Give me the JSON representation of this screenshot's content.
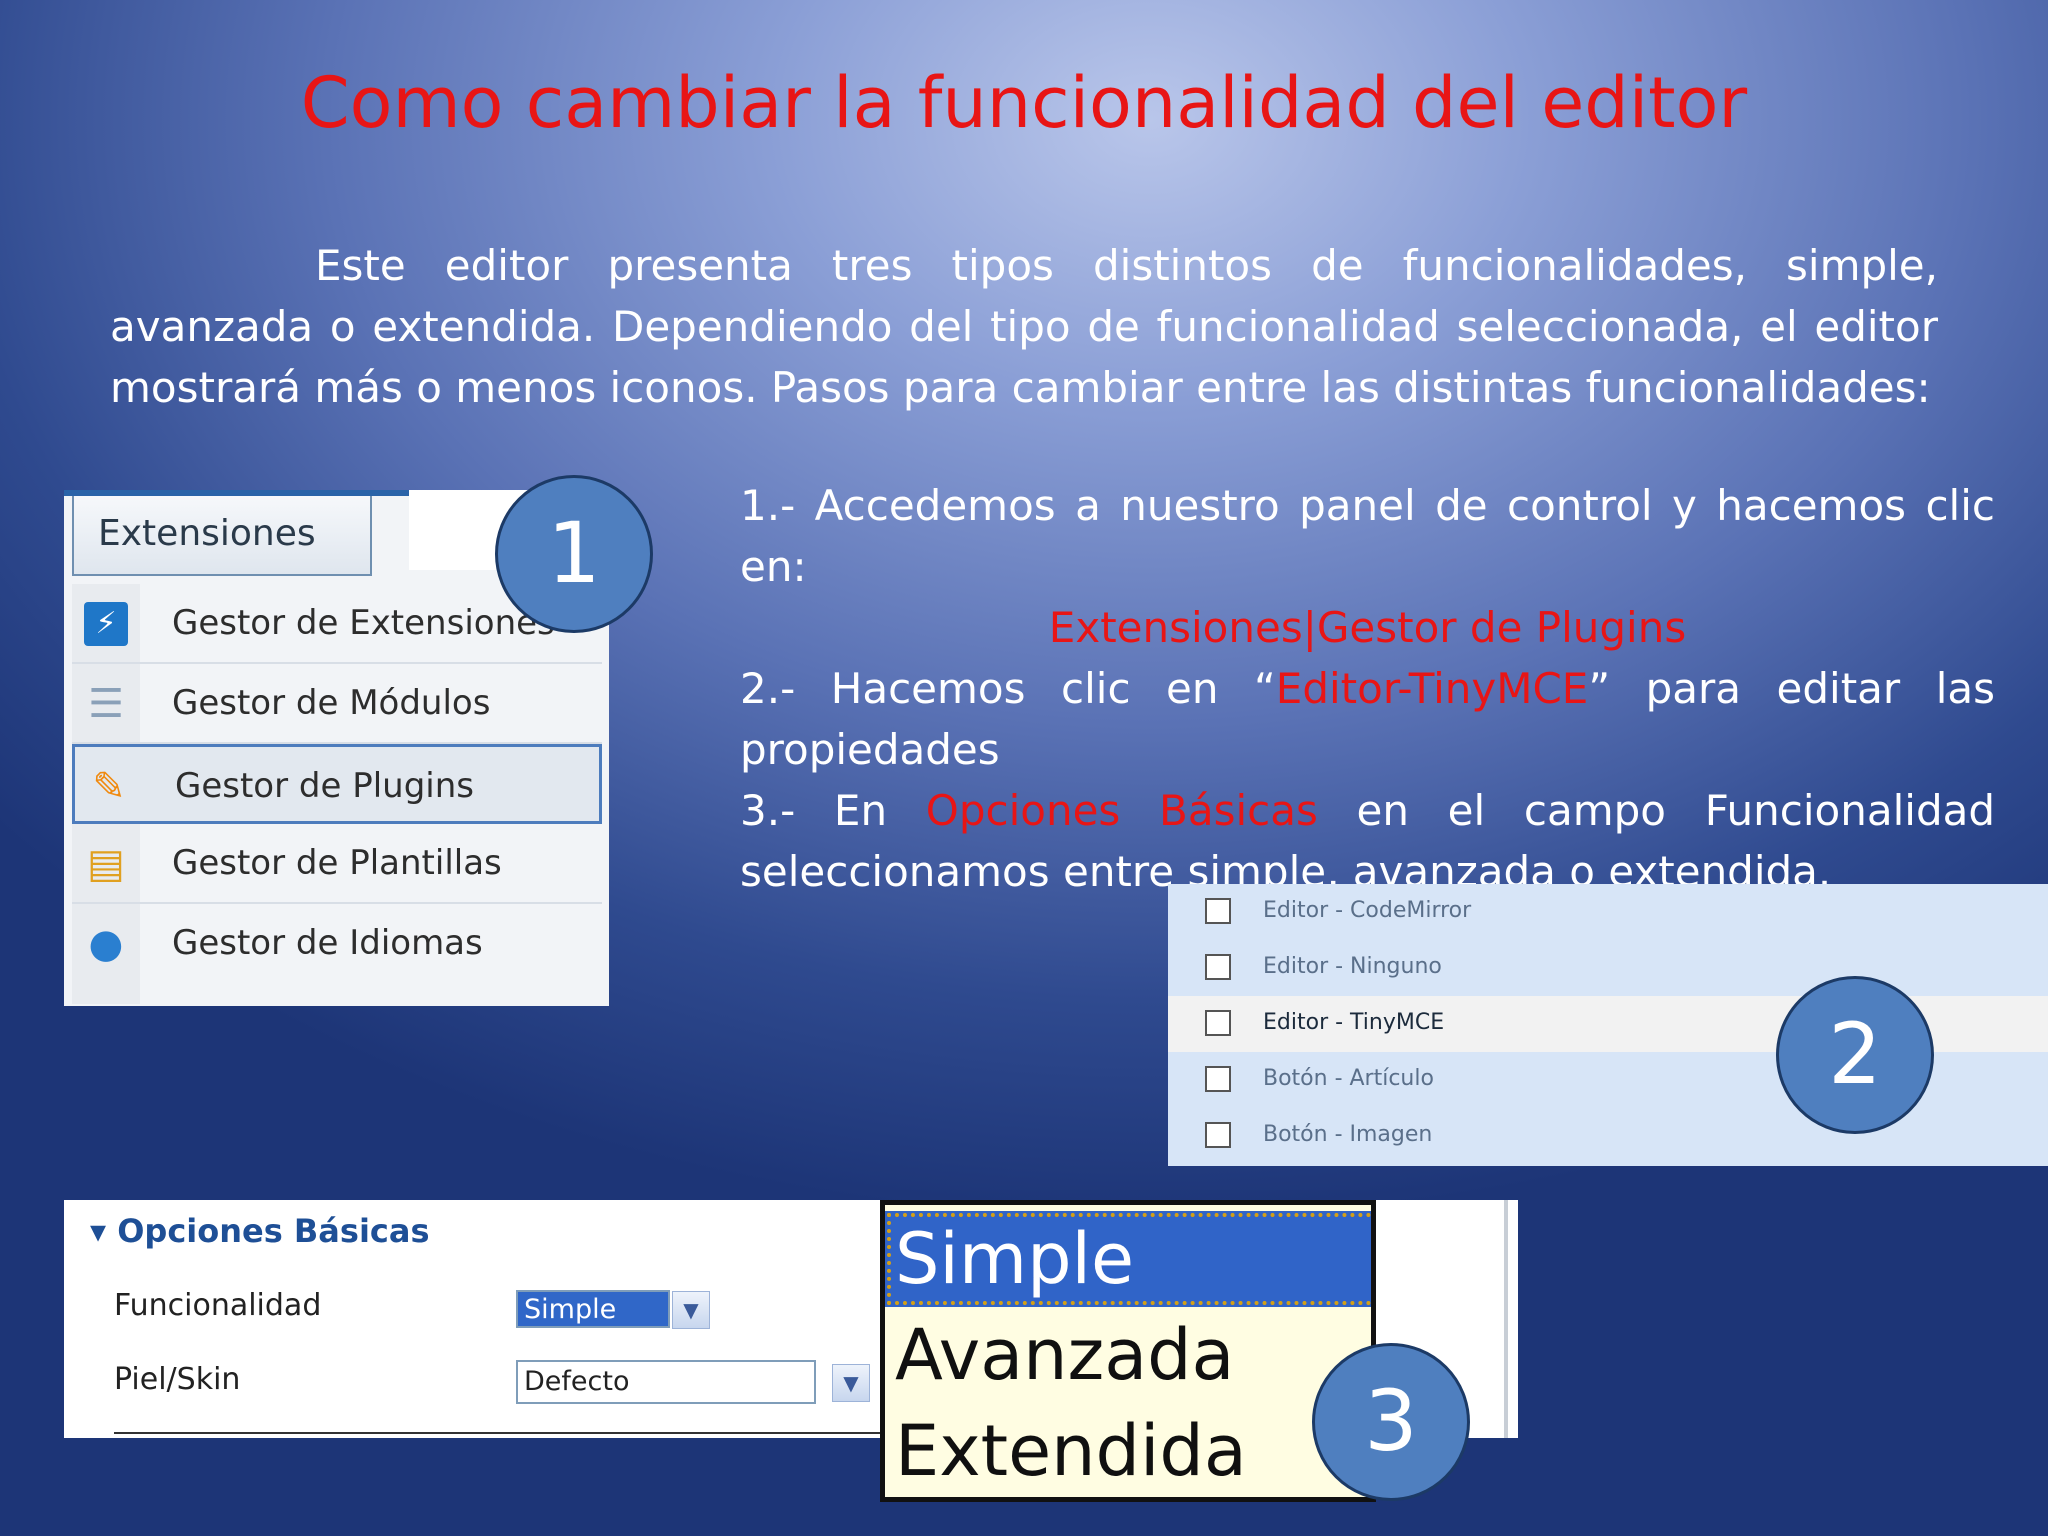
{
  "slide": {
    "title": "Como cambiar la funcionalidad del editor",
    "intro": "Este editor presenta tres tipos distintos de funcionalidades, simple, avanzada o extendida. Dependiendo del tipo de funcionalidad seleccionada, el editor mostrará más o menos iconos. Pasos para cambiar entre las distintas funcionalidades:",
    "step1_text": "1.- Accedemos a nuestro panel de control y hacemos clic en:",
    "step1_path": "Extensiones|Gestor de Plugins",
    "step2_pre": "2.- Hacemos clic en “",
    "step2_highlight": "Editor-TinyMCE",
    "step2_post": "” para editar las propiedades",
    "step3_pre": "3.- En ",
    "step3_highlight": "Opciones Básicas",
    "step3_post": " en el campo Funcionalidad seleccionamos entre simple, avanzada o extendida."
  },
  "badges": [
    "1",
    "2",
    "3"
  ],
  "panel1": {
    "tab": "Extensiones",
    "items": [
      {
        "label": "Gestor de Extensiones",
        "icon": "extension-icon"
      },
      {
        "label": "Gestor de Módulos",
        "icon": "modules-icon"
      },
      {
        "label": "Gestor de Plugins",
        "icon": "plugin-icon"
      },
      {
        "label": "Gestor de Plantillas",
        "icon": "template-icon"
      },
      {
        "label": "Gestor de Idiomas",
        "icon": "globe-icon"
      }
    ],
    "selected_index": 2
  },
  "panel2": {
    "rows": [
      "Editor - CodeMirror",
      "Editor - Ninguno",
      "Editor - TinyMCE",
      "Botón - Artículo",
      "Botón - Imagen"
    ],
    "selected_index": 2
  },
  "panel3": {
    "header": "Opciones Básicas",
    "field1_label": "Funcionalidad",
    "field1_value": "Simple",
    "field2_label": "Piel/Skin",
    "field2_value": "Defecto"
  },
  "dropdown": {
    "options": [
      "Simple",
      "Avanzada",
      "Extendida"
    ],
    "selected_index": 0
  },
  "colors": {
    "accent_red": "#e81515",
    "badge_blue": "#4f7fbf"
  }
}
